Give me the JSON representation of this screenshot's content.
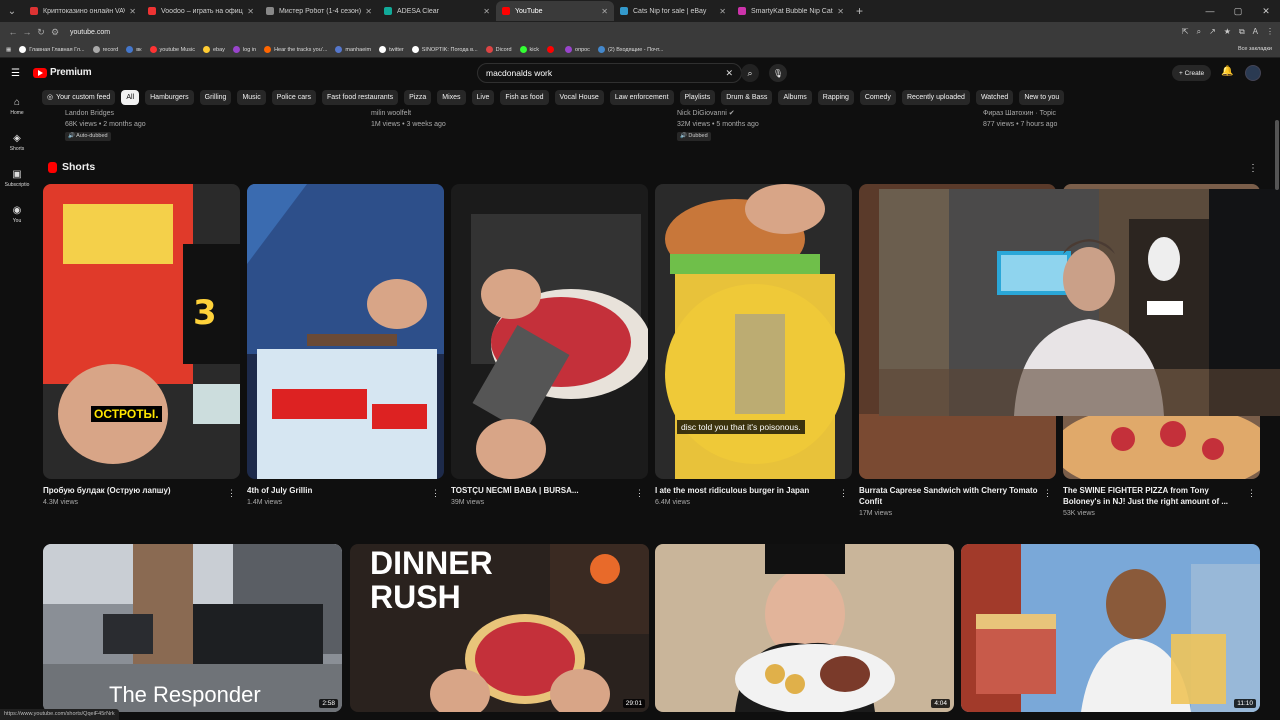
{
  "browser": {
    "tabs": [
      {
        "title": "Криптоказино онлайн VAVADA",
        "color": "#d33"
      },
      {
        "title": "Voodoo – играть на официал...",
        "color": "#e33"
      },
      {
        "title": "Мистер Робот (1-4 сезон) смо...",
        "color": "#888"
      },
      {
        "title": "ADESA Clear",
        "color": "#1a9"
      },
      {
        "title": "YouTube",
        "color": "#f00",
        "active": true
      },
      {
        "title": "Cats Nip for sale | eBay",
        "color": "#39c"
      },
      {
        "title": "SmartyKat Bubble Nip Catnip B...",
        "color": "#c3a"
      }
    ],
    "url": "youtube.com",
    "bookmarks": [
      {
        "label": "Главная Главная Гл...",
        "color": "#fff"
      },
      {
        "label": "record",
        "color": "#aaa"
      },
      {
        "label": "вк",
        "color": "#47c"
      },
      {
        "label": "youtube Music",
        "color": "#f33"
      },
      {
        "label": "ebay",
        "color": "#fc3"
      },
      {
        "label": "log in",
        "color": "#94c"
      },
      {
        "label": "Hear the tracks you'...",
        "color": "#f60"
      },
      {
        "label": "manhaeim",
        "color": "#57c"
      },
      {
        "label": "twitter",
        "color": "#fff"
      },
      {
        "label": "SINOPTIK: Погода в...",
        "color": "#fff"
      },
      {
        "label": "Dicord",
        "color": "#d44"
      },
      {
        "label": "kick",
        "color": "#3f3"
      },
      {
        "label": "",
        "color": "#f00"
      },
      {
        "label": "опрос",
        "color": "#94c"
      },
      {
        "label": "(2) Входящие - Почт...",
        "color": "#48c"
      }
    ],
    "bookmarks_right": "Все закладки",
    "status_url": "https://www.youtube.com/shorts/QqeiF45rNrk"
  },
  "youtube": {
    "brand": "Premium",
    "search_value": "macdonalds work",
    "create_label": "Create",
    "sidenav": [
      {
        "label": "Home",
        "icon": "home-icon",
        "glyph": "⌂"
      },
      {
        "label": "Shorts",
        "icon": "shorts-icon",
        "glyph": "◈"
      },
      {
        "label": "Subscriptio",
        "icon": "subscriptions-icon",
        "glyph": "▣"
      },
      {
        "label": "You",
        "icon": "user-icon",
        "glyph": "◉"
      }
    ],
    "chips": [
      "Your custom feed",
      "All",
      "Hamburgers",
      "Grilling",
      "Music",
      "Police cars",
      "Fast food restaurants",
      "Pizza",
      "Mixes",
      "Live",
      "Fish as food",
      "Vocal House",
      "Law enforcement",
      "Playlists",
      "Drum & Bass",
      "Albums",
      "Rapping",
      "Comedy",
      "Recently uploaded",
      "Watched",
      "New to you"
    ],
    "active_chip": "All",
    "top_meta": [
      {
        "channel": "Landon Bridges",
        "stats": "68K views • 2 months ago",
        "badge": "Auto-dubbed"
      },
      {
        "channel": "milin woolfelt",
        "stats": "1M views • 3 weeks ago",
        "badge": ""
      },
      {
        "channel": "Nick DiGiovanni ✔",
        "stats": "32M views • 5 months ago",
        "badge": "Dubbed"
      },
      {
        "channel": "Фираз Шатохин · Topic",
        "stats": "877 views • 7 hours ago",
        "badge": ""
      }
    ],
    "shorts_title": "Shorts",
    "shorts": [
      {
        "title": "Пробую булдак (Острую лапшу)",
        "views": "4.3M views",
        "caption": "ОСТРОТЫ."
      },
      {
        "title": "4th of July Grillin",
        "views": "1.4M views",
        "caption": ""
      },
      {
        "title": "TOSTÇU NECMİ BABA | BURSA...",
        "views": "39M views",
        "caption": ""
      },
      {
        "title": "I ate the most ridiculous burger in Japan",
        "views": "6.4M views",
        "caption": "disc told you that it's poisonous."
      },
      {
        "title": "Burrata Caprese Sandwich with Cherry Tomato Confit",
        "views": "17M views",
        "caption": ""
      },
      {
        "title": "The SWINE FIGHTER PIZZA from Tony Boloney's in NJ! Just the right amount of ...",
        "views": "53K views",
        "caption": ""
      }
    ],
    "videos": [
      {
        "overlay": "The Responder",
        "duration": "2:58"
      },
      {
        "overlay": "DINNER RUSH",
        "duration": "29:01"
      },
      {
        "overlay": "",
        "duration": "4:04"
      },
      {
        "overlay": "",
        "duration": "11:10"
      }
    ]
  }
}
